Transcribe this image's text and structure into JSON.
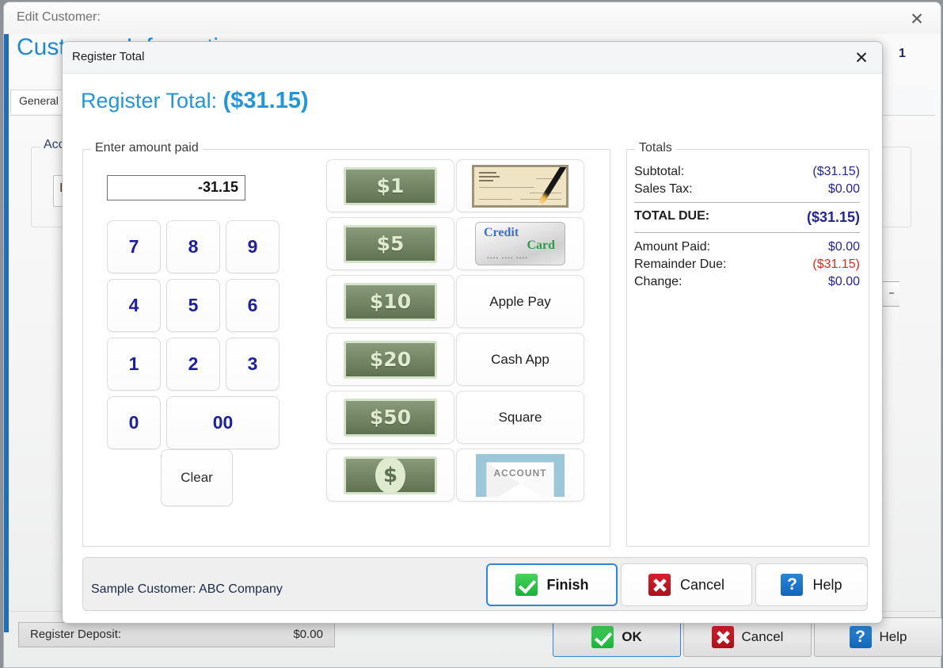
{
  "background_window": {
    "title": "Edit Customer:",
    "close_icon": "close-icon",
    "heading": "Customer Information",
    "tab_label": "General Information",
    "group_label": "Account Information",
    "field_value": "ID",
    "corner_number": "1",
    "deposit_label": "Register Deposit:",
    "deposit_value": "$0.00",
    "buttons": [
      {
        "label": "OK",
        "icon": "green-check-icon"
      },
      {
        "label": "Cancel",
        "icon": "red-x-icon"
      },
      {
        "label": "Help",
        "icon": "blue-question-icon"
      }
    ]
  },
  "dialog": {
    "titlebar": {
      "title": "Register Total",
      "close_icon": "close-icon"
    },
    "heading_label": "Register Total:",
    "heading_amount": "($31.15)",
    "enter_group": {
      "label": "Enter amount paid",
      "amount_value": "-31.15",
      "keypad": [
        [
          "7",
          "8",
          "9"
        ],
        [
          "4",
          "5",
          "6"
        ],
        [
          "1",
          "2",
          "3"
        ]
      ],
      "zero_key": "0",
      "double_zero_key": "00",
      "clear_key": "Clear",
      "denominations": [
        {
          "label": "$1",
          "icon": "dollar-bill-icon"
        },
        {
          "label": "$5",
          "icon": "dollar-bill-icon"
        },
        {
          "label": "$10",
          "icon": "dollar-bill-icon"
        },
        {
          "label": "$20",
          "icon": "dollar-bill-icon"
        },
        {
          "label": "$50",
          "icon": "dollar-bill-icon"
        },
        {
          "label": "$",
          "icon": "dollar-coin-bill-icon"
        }
      ],
      "methods": [
        {
          "label": "Check",
          "icon": "check-with-pencil-icon",
          "text_visible": false
        },
        {
          "label": "Credit Card",
          "icon": "credit-card-icon",
          "text_visible": false,
          "card_line1": "Credit",
          "card_line2": "Card",
          "card_line3": "•••• •••• ••••"
        },
        {
          "label": "Apple Pay",
          "icon": "",
          "text_visible": true
        },
        {
          "label": "Cash App",
          "icon": "",
          "text_visible": true
        },
        {
          "label": "Square",
          "icon": "",
          "text_visible": true
        },
        {
          "label": "ACCOUNT",
          "icon": "account-envelope-icon",
          "text_visible": false
        }
      ]
    },
    "totals_group": {
      "label": "Totals",
      "rows": [
        {
          "label": "Subtotal:",
          "value": "($31.15)",
          "style": "normal"
        },
        {
          "label": "Sales Tax:",
          "value": "$0.00",
          "style": "normal"
        },
        {
          "label": "TOTAL DUE:",
          "value": "($31.15)",
          "style": "bold"
        },
        {
          "label": "Amount Paid:",
          "value": "$0.00",
          "style": "normal"
        },
        {
          "label": "Remainder Due:",
          "value": "($31.15)",
          "style": "red"
        },
        {
          "label": "Change:",
          "value": "$0.00",
          "style": "normal"
        }
      ]
    },
    "footer": {
      "note": "Sample Customer: ABC Company",
      "buttons": [
        {
          "label": "Finish",
          "icon": "green-check-icon"
        },
        {
          "label": "Cancel",
          "icon": "red-x-icon"
        },
        {
          "label": "Help",
          "icon": "blue-question-icon"
        }
      ]
    }
  },
  "colors": {
    "accent_blue": "#2196d8",
    "value_blue": "#24249c",
    "alert_red": "#e02b1c",
    "bill_green": "#5f7251",
    "focus_blue": "#2f86d8"
  }
}
